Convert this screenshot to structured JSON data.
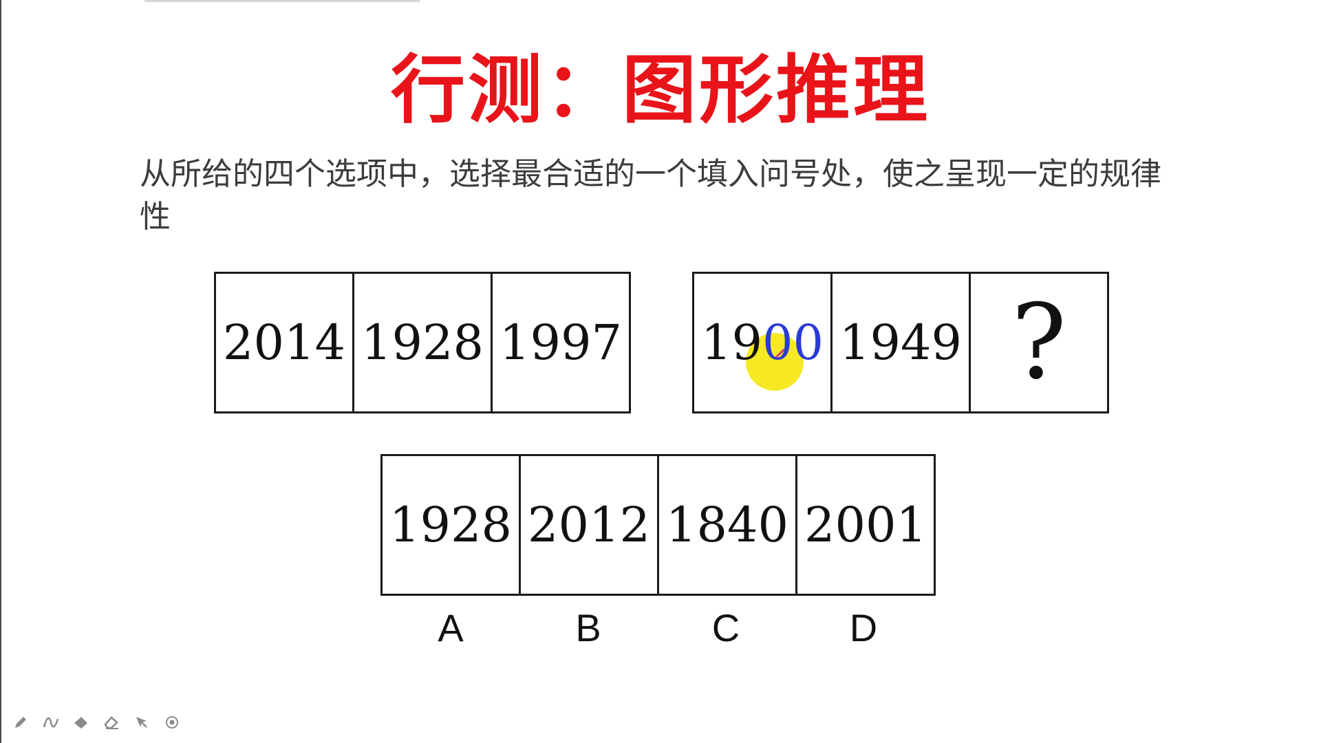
{
  "slide": {
    "title": "行测：图形推理",
    "instruction": "从所给的四个选项中，选择最合适的一个填入问号处，使之呈现一定的规律性"
  },
  "question": {
    "left_group": [
      "2014",
      "1928",
      "1997"
    ],
    "right_group_1": "19",
    "right_group_1b": "00",
    "right_group_2": "1949",
    "unknown": "?"
  },
  "options": {
    "values": [
      "1928",
      "2012",
      "1840",
      "2001"
    ],
    "labels": [
      "A",
      "B",
      "C",
      "D"
    ]
  },
  "toolbar": {
    "icons": [
      "pen-icon",
      "curve-icon",
      "marker-icon",
      "eraser-icon",
      "pointer-icon",
      "record-icon"
    ]
  },
  "colors": {
    "title": "#e8141a",
    "highlight": "#f5e70c",
    "annotation_blue": "#2b3bd8"
  }
}
